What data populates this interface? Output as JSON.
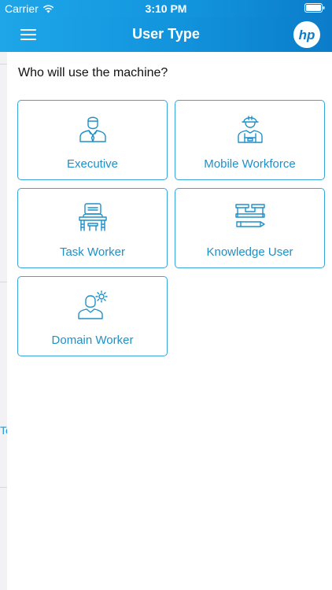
{
  "status_bar": {
    "carrier": "Carrier",
    "time": "3:10 PM"
  },
  "nav": {
    "title": "User Type",
    "menu_icon": "hamburger-menu-icon",
    "logo_text": "hp"
  },
  "background_fragment": "Te",
  "main": {
    "question": "Who will use the machine?",
    "options": [
      {
        "label": "Executive",
        "icon": "executive-icon"
      },
      {
        "label": "Mobile Workforce",
        "icon": "hardhat-worker-icon"
      },
      {
        "label": "Task Worker",
        "icon": "desk-worker-icon"
      },
      {
        "label": "Knowledge User",
        "icon": "desk-pencil-icon"
      },
      {
        "label": "Domain Worker",
        "icon": "user-gear-icon"
      }
    ]
  },
  "colors": {
    "accent": "#1e90c8",
    "header": "#1293dc",
    "card_border": "#38a6dd"
  }
}
